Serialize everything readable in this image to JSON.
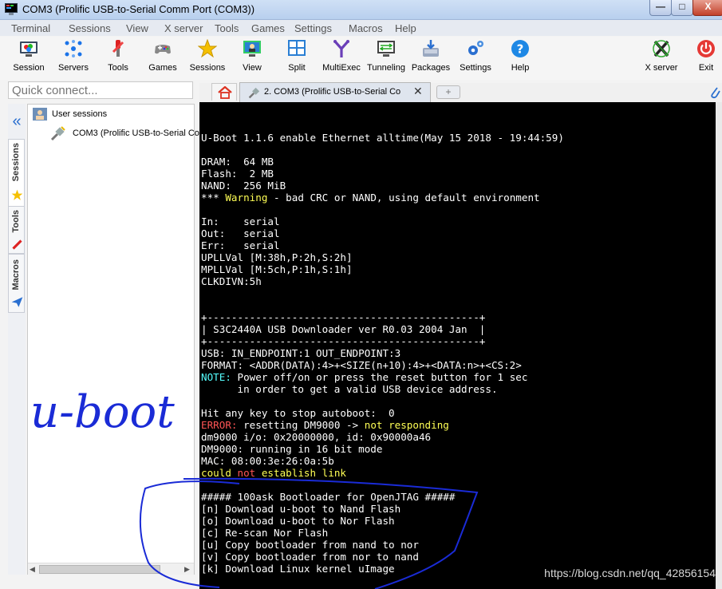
{
  "window": {
    "title": "COM3  (Prolific USB-to-Serial Comm Port (COM3))",
    "buttons": {
      "minimize": "—",
      "maximize": "□",
      "close": "X"
    }
  },
  "menu": [
    "Terminal",
    "Sessions",
    "View",
    "X server",
    "Tools",
    "Games",
    "Settings",
    "Macros",
    "Help"
  ],
  "toolbar": {
    "session": "Session",
    "servers": "Servers",
    "tools": "Tools",
    "games": "Games",
    "sessions": "Sessions",
    "view": "View",
    "split": "Split",
    "multiexec": "MultiExec",
    "tunneling": "Tunneling",
    "packages": "Packages",
    "settings": "Settings",
    "help": "Help",
    "xserver": "X server",
    "exit": "Exit"
  },
  "quick_connect": {
    "placeholder": "Quick connect..."
  },
  "side_tabs": {
    "sessions": "Sessions",
    "tools": "Tools",
    "macros": "Macros"
  },
  "tree": {
    "root": "User sessions",
    "item": "COM3  (Prolific USB-to-Serial Co"
  },
  "tabs": {
    "active": "2. COM3  (Prolific USB-to-Serial Co",
    "new_tab": "+"
  },
  "terminal": {
    "banner": "U-Boot 1.1.6 enable Ethernet alltime(May 15 2018 - 19:44:59)",
    "dram": "DRAM:  64 MB",
    "flash": "Flash:  2 MB",
    "nand": "NAND:  256 MiB",
    "warn_pre": "*** ",
    "warn_word": "Warning",
    "warn_post": " - bad CRC or NAND, using default environment",
    "in": "In:    serial",
    "out": "Out:   serial",
    "err": "Err:   serial",
    "upll": "UPLLVal [M:38h,P:2h,S:2h]",
    "mpll": "MPLLVal [M:5ch,P:1h,S:1h]",
    "clkdivn": "CLKDIVN:5h",
    "box_top": "+---------------------------------------------+",
    "box_mid": "| S3C2440A USB Downloader ver R0.03 2004 Jan  |",
    "box_bot": "+---------------------------------------------+",
    "usb": "USB: IN_ENDPOINT:1 OUT_ENDPOINT:3",
    "format": "FORMAT: <ADDR(DATA):4>+<SIZE(n+10):4>+<DATA:n>+<CS:2>",
    "note_word": "NOTE:",
    "note_rest": " Power off/on or press the reset button for 1 sec",
    "note_line2": "      in order to get a valid USB device address.",
    "autoboot": "Hit any key to stop autoboot:  0",
    "error_word": "ERROR:",
    "error_mid": " resetting DM9000 -> ",
    "error_tail": "not responding",
    "dm9000_io": "dm9000 i/o: 0x20000000, id: 0x90000a46",
    "dm9000_mode": "DM9000: running in 16 bit mode",
    "mac": "MAC: 08:00:3e:26:0a:5b",
    "link_a": "could ",
    "link_b": "not",
    "link_c": " establish link",
    "menu_title": "##### 100ask Bootloader for OpenJTAG #####",
    "opt_n": "[n] Download u-boot to Nand Flash",
    "opt_o": "[o] Download u-boot to Nor Flash",
    "opt_c": "[c] Re-scan Nor Flash",
    "opt_u": "[u] Copy bootloader from nand to nor",
    "opt_v": "[v] Copy bootloader from nor to nand",
    "opt_k": "[k] Download Linux kernel uImage"
  },
  "annotation": "u-boot",
  "watermark": "https://blog.csdn.net/qq_42856154",
  "colors": {
    "terminal_bg": "#000000",
    "warning": "#ffff55",
    "error": "#ff5555",
    "note": "#55ffff",
    "ink": "#1a2bd6"
  }
}
